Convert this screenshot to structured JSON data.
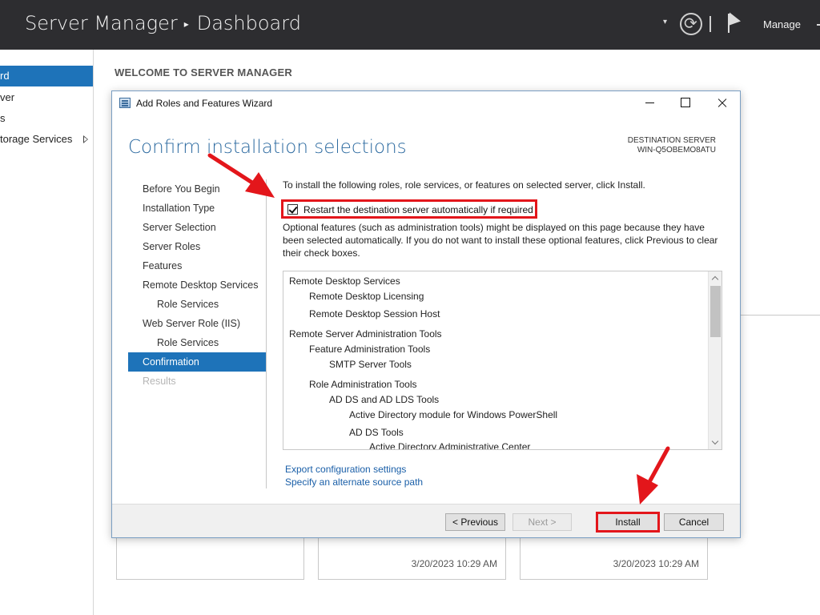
{
  "server_manager": {
    "title": "Server Manager",
    "breadcrumb": "Dashboard",
    "manage_label": "Manage",
    "nav_items": [
      {
        "label": "rd",
        "selected": true
      },
      {
        "label": "ver"
      },
      {
        "label": "s"
      },
      {
        "label": "torage Services"
      }
    ],
    "welcome": "WELCOME TO SERVER MANAGER",
    "tile_timestamps": [
      "3/20/2023 10:29 AM",
      "3/20/2023 10:29 AM"
    ]
  },
  "wizard": {
    "window_title": "Add Roles and Features Wizard",
    "heading": "Confirm installation selections",
    "destination_label": "DESTINATION SERVER",
    "destination_server": "WIN-Q5OBEMO8ATU",
    "steps": [
      {
        "label": "Before You Begin"
      },
      {
        "label": "Installation Type"
      },
      {
        "label": "Server Selection"
      },
      {
        "label": "Server Roles"
      },
      {
        "label": "Features"
      },
      {
        "label": "Remote Desktop Services"
      },
      {
        "label": "Role Services",
        "sub": true
      },
      {
        "label": "Web Server Role (IIS)"
      },
      {
        "label": "Role Services",
        "sub": true
      },
      {
        "label": "Confirmation",
        "active": true
      },
      {
        "label": "Results",
        "disabled": true
      }
    ],
    "intro": "To install the following roles, role services, or features on selected server, click Install.",
    "restart_label": "Restart the destination server automatically if required",
    "restart_checked": true,
    "optional_text": "Optional features (such as administration tools) might be displayed on this page because they have been selected automatically. If you do not want to install these optional features, click Previous to clear their check boxes.",
    "features": [
      {
        "label": "Remote Desktop Services",
        "level": 0
      },
      {
        "label": "Remote Desktop Licensing",
        "level": 1
      },
      {
        "label": "Remote Desktop Session Host",
        "level": 1
      },
      {
        "label": "Remote Server Administration Tools",
        "level": 0
      },
      {
        "label": "Feature Administration Tools",
        "level": 1
      },
      {
        "label": "SMTP Server Tools",
        "level": 2
      },
      {
        "label": "Role Administration Tools",
        "level": 1
      },
      {
        "label": "AD DS and AD LDS Tools",
        "level": 2
      },
      {
        "label": "Active Directory module for Windows PowerShell",
        "level": 3
      },
      {
        "label": "AD DS Tools",
        "level": 3
      },
      {
        "label": "Active Directory Administrative Center",
        "level": 4
      }
    ],
    "export_link": "Export configuration settings",
    "alt_source_link": "Specify an alternate source path",
    "buttons": {
      "previous": "< Previous",
      "next": "Next >",
      "install": "Install",
      "cancel": "Cancel"
    }
  },
  "colors": {
    "titlebar_bg": "#2d2d30",
    "selection_blue": "#1e73b9",
    "heading_blue": "#2c6aa0",
    "link_blue": "#1a5fa8",
    "highlight_red": "#e3161b"
  }
}
